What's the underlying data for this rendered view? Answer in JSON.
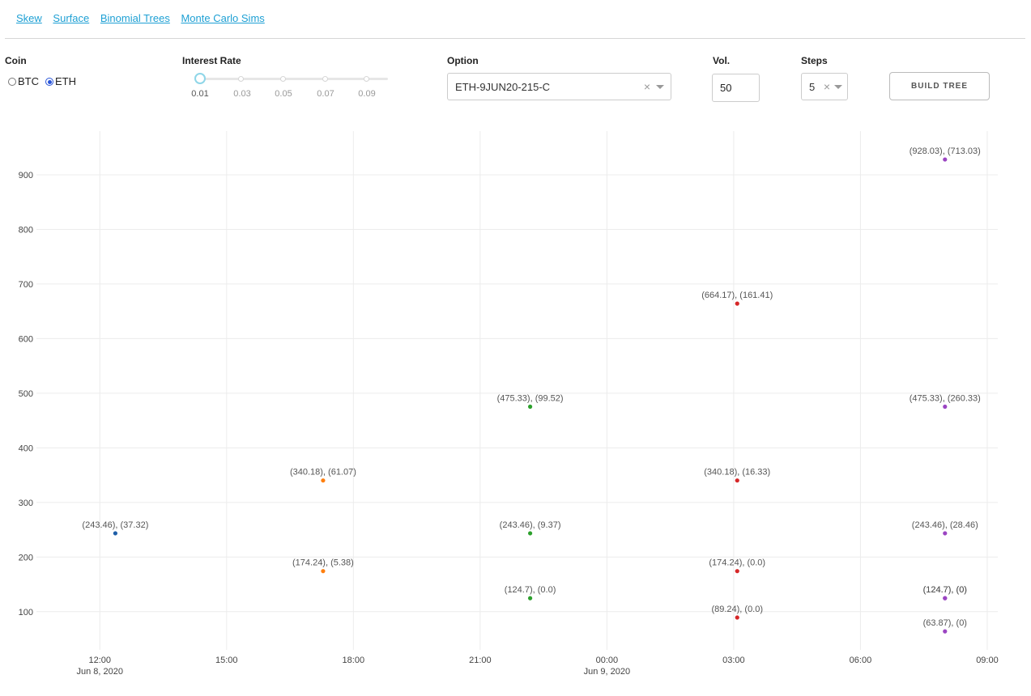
{
  "nav": {
    "links": [
      {
        "label": "Skew"
      },
      {
        "label": "Surface"
      },
      {
        "label": "Binomial Trees"
      },
      {
        "label": "Monte Carlo Sims"
      }
    ]
  },
  "controls": {
    "coin": {
      "label": "Coin",
      "options": [
        {
          "label": "BTC",
          "checked": false
        },
        {
          "label": "ETH",
          "checked": true
        }
      ]
    },
    "interest_rate": {
      "label": "Interest Rate",
      "value": 0.01,
      "ticks": [
        "0.01",
        "0.03",
        "0.05",
        "0.07",
        "0.09"
      ]
    },
    "option": {
      "label": "Option",
      "value": "ETH-9JUN20-215-C",
      "clear_icon": "×"
    },
    "vol": {
      "label": "Vol.",
      "value": "50"
    },
    "steps": {
      "label": "Steps",
      "value": "5",
      "clear_icon": "×"
    },
    "build_button": "BUILD TREE"
  },
  "chart_data": {
    "type": "scatter",
    "x_ticks": [
      {
        "label": "12:00",
        "sub": "Jun 8, 2020"
      },
      {
        "label": "15:00",
        "sub": ""
      },
      {
        "label": "18:00",
        "sub": ""
      },
      {
        "label": "21:00",
        "sub": ""
      },
      {
        "label": "00:00",
        "sub": "Jun 9, 2020"
      },
      {
        "label": "03:00",
        "sub": ""
      },
      {
        "label": "06:00",
        "sub": ""
      },
      {
        "label": "09:00",
        "sub": ""
      }
    ],
    "xlim": [
      "2020-06-08T10:30",
      "2020-06-09T09:15"
    ],
    "ylim": [
      30,
      980
    ],
    "y_ticks": [
      100,
      200,
      300,
      400,
      500,
      600,
      700,
      800,
      900
    ],
    "grid": true,
    "series": [
      {
        "color": "#1f5fa8",
        "points": [
          {
            "x": "2020-06-08T12:22",
            "y": 243.46,
            "label": "(243.46), (37.32)"
          }
        ]
      },
      {
        "color": "#ff7f0e",
        "points": [
          {
            "x": "2020-06-08T17:17",
            "y": 340.18,
            "label": "(340.18), (61.07)"
          },
          {
            "x": "2020-06-08T17:17",
            "y": 174.24,
            "label": "(174.24), (5.38)"
          }
        ]
      },
      {
        "color": "#2ca02c",
        "points": [
          {
            "x": "2020-06-08T22:11",
            "y": 475.33,
            "label": "(475.33), (99.52)"
          },
          {
            "x": "2020-06-08T22:11",
            "y": 243.46,
            "label": "(243.46), (9.37)"
          },
          {
            "x": "2020-06-08T22:11",
            "y": 124.7,
            "label": "(124.7), (0.0)"
          }
        ]
      },
      {
        "color": "#d62728",
        "points": [
          {
            "x": "2020-06-09T03:05",
            "y": 664.17,
            "label": "(664.17), (161.41)"
          },
          {
            "x": "2020-06-09T03:05",
            "y": 340.18,
            "label": "(340.18), (16.33)"
          },
          {
            "x": "2020-06-09T03:05",
            "y": 174.24,
            "label": "(174.24), (0.0)"
          },
          {
            "x": "2020-06-09T03:05",
            "y": 89.24,
            "label": "(89.24), (0.0)"
          }
        ]
      },
      {
        "color": "#9b45c2",
        "points": [
          {
            "x": "2020-06-09T08:00",
            "y": 928.03,
            "label": "(928.03), (713.03)"
          },
          {
            "x": "2020-06-09T08:00",
            "y": 475.33,
            "label": "(475.33), (260.33)"
          },
          {
            "x": "2020-06-09T08:00",
            "y": 243.46,
            "label": "(243.46), (28.46)"
          },
          {
            "x": "2020-06-09T08:00",
            "y": 124.7,
            "label": "(124.7), (0)"
          },
          {
            "x": "2020-06-09T08:00",
            "y": 124.7,
            "label": "(124.7), (0)"
          },
          {
            "x": "2020-06-09T08:00",
            "y": 63.87,
            "label": "(63.87), (0)"
          }
        ]
      }
    ]
  }
}
